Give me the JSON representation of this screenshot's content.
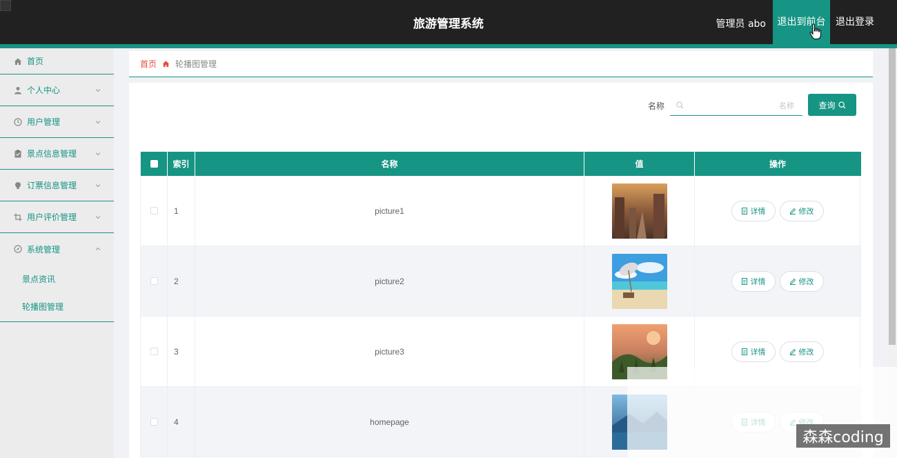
{
  "header": {
    "title": "旅游管理系统",
    "user_label": "管理员 abo",
    "front_button": "退出到前台",
    "logout_button": "退出登录"
  },
  "sidebar": {
    "items": [
      {
        "label": "首页",
        "icon": "home-icon"
      },
      {
        "label": "个人中心",
        "icon": "user-icon"
      },
      {
        "label": "用户管理",
        "icon": "clock-icon"
      },
      {
        "label": "景点信息管理",
        "icon": "clipboard-icon"
      },
      {
        "label": "订票信息管理",
        "icon": "bulb-icon"
      },
      {
        "label": "用户评价管理",
        "icon": "crop-icon"
      },
      {
        "label": "系统管理",
        "icon": "compass-icon",
        "expanded": true
      }
    ],
    "sub_items": [
      {
        "label": "景点资讯"
      },
      {
        "label": "轮播图管理"
      }
    ]
  },
  "breadcrumb": {
    "home": "首页",
    "current": "轮播图管理"
  },
  "search": {
    "label": "名称",
    "placeholder": "名称",
    "button": "查询"
  },
  "table": {
    "headers": [
      "索引",
      "名称",
      "值",
      "操作"
    ],
    "rows": [
      {
        "index": "1",
        "name": "picture1",
        "image": "street-photo"
      },
      {
        "index": "2",
        "name": "picture2",
        "image": "beach-photo"
      },
      {
        "index": "3",
        "name": "picture3",
        "image": "village-photo"
      },
      {
        "index": "4",
        "name": "homepage",
        "image": "lake-photo"
      }
    ],
    "detail_label": "详情",
    "edit_label": "修改"
  },
  "watermark": "森森coding",
  "colors": {
    "header_bg": "#212121",
    "accent": "#169484",
    "sidebar_bg": "#ececec",
    "breadcrumb_home": "#e74c3c"
  }
}
